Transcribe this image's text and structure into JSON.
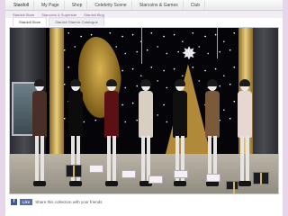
{
  "nav": {
    "items": [
      "Stardoll",
      "My Page",
      "Shop",
      "Celebrity Scene",
      "Starcoins & Games",
      "Club"
    ]
  },
  "banner": {
    "items": [
      "Stardoll Store",
      "Starcoins & Superstar",
      "Stardoll Blog"
    ]
  },
  "tabs": [
    "Stardoll Store",
    "Stardoll Starmix Catalogue"
  ],
  "scene": {
    "models": [
      {
        "dress_color": "#4a2e28",
        "price": ""
      },
      {
        "dress_color": "#0c0c0c",
        "price": ""
      },
      {
        "dress_color": "#5b1013",
        "price": ""
      },
      {
        "dress_color": "#d8cfc2",
        "price": ""
      },
      {
        "dress_color": "#101010",
        "price": ""
      },
      {
        "dress_color": "#7a5a3a",
        "price": ""
      },
      {
        "dress_color": "#e7d7d2",
        "price": ""
      }
    ]
  },
  "footer": {
    "share_text": "Share this collection with your friends",
    "like_label": "Like"
  }
}
